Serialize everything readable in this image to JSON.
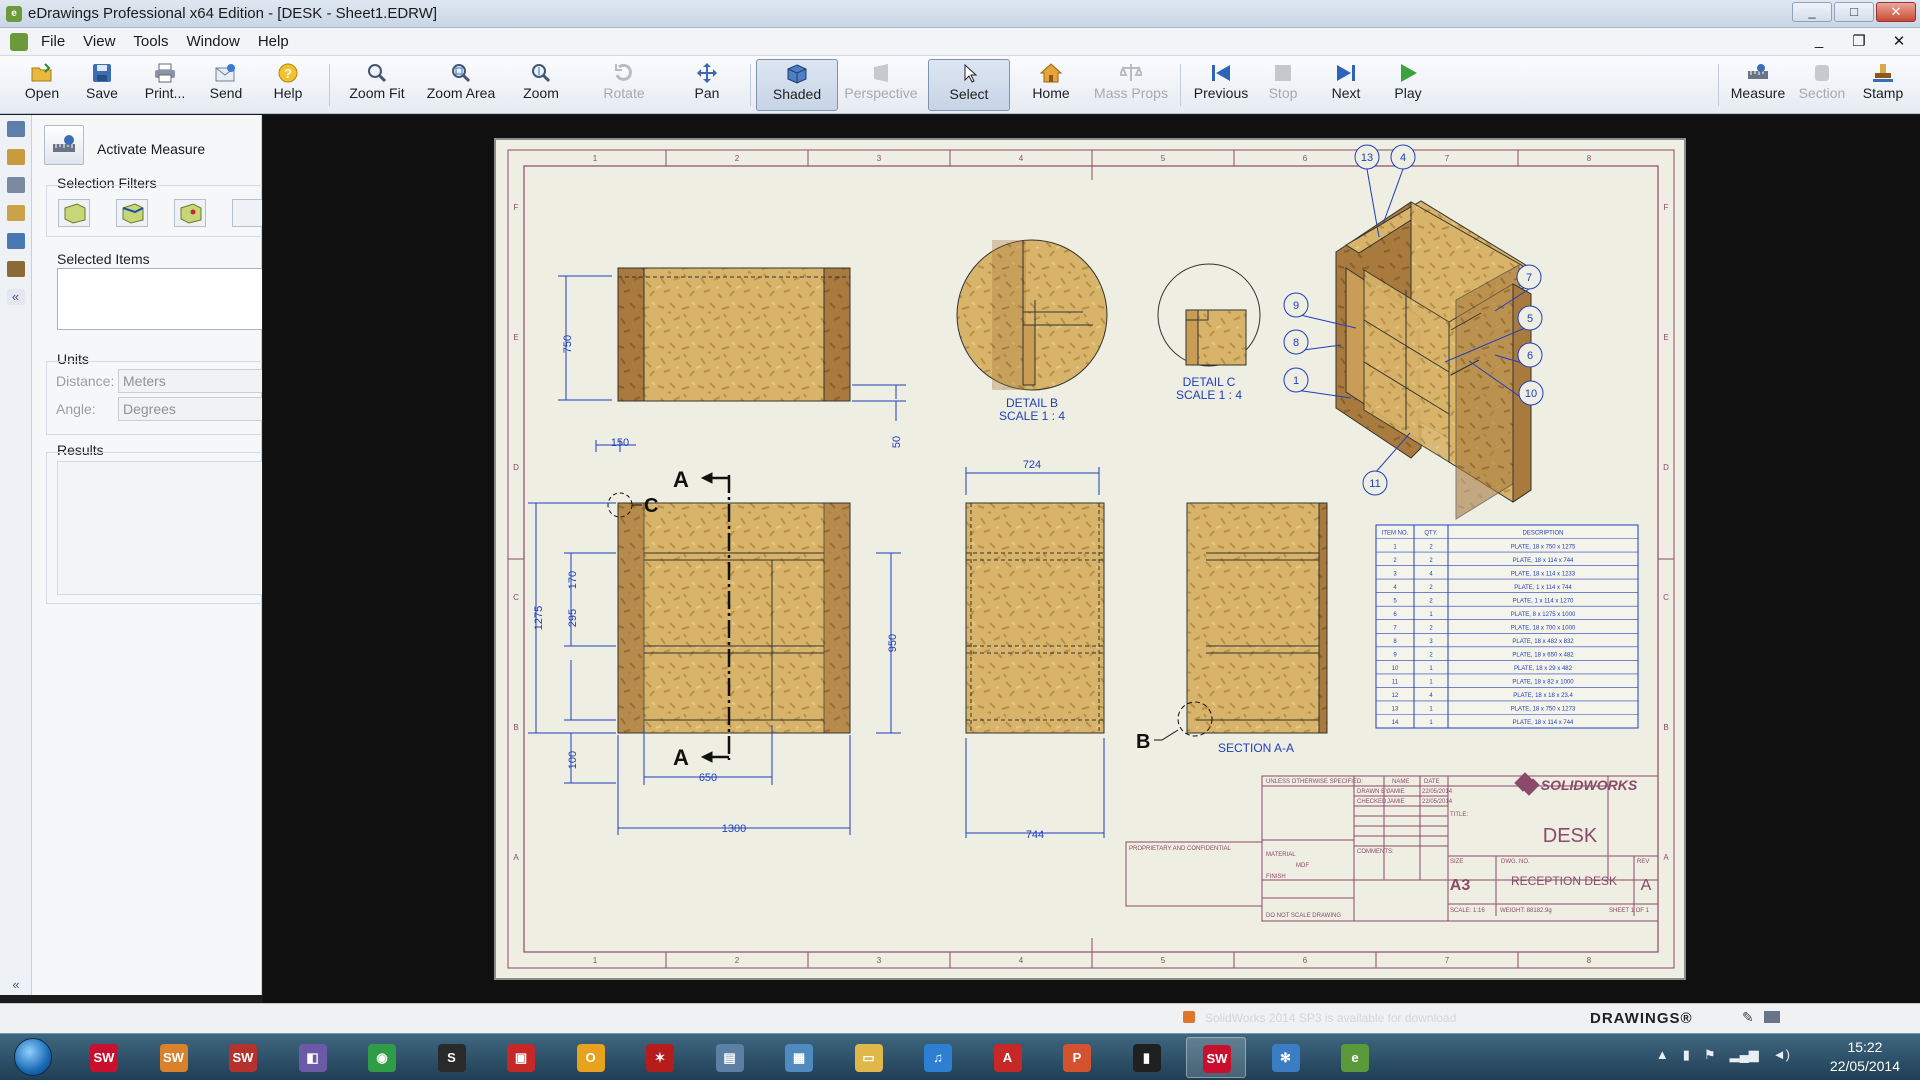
{
  "window": {
    "title": "eDrawings Professional x64 Edition - [DESK - Sheet1.EDRW]",
    "controls": [
      "_",
      "□",
      "✕"
    ]
  },
  "menu": {
    "items": [
      "File",
      "View",
      "Tools",
      "Window",
      "Help"
    ],
    "mdi_controls": [
      "_",
      "❐",
      "✕"
    ]
  },
  "toolbar": {
    "buttons": [
      {
        "label": "Open",
        "icon": "open-folder-icon",
        "enabled": true
      },
      {
        "label": "Save",
        "icon": "save-disk-icon",
        "enabled": true
      },
      {
        "label": "Print...",
        "icon": "printer-icon",
        "enabled": true
      },
      {
        "label": "Send",
        "icon": "send-mail-icon",
        "enabled": true
      },
      {
        "label": "Help",
        "icon": "help-icon",
        "enabled": true
      },
      {
        "label": "Zoom Fit",
        "icon": "zoom-fit-icon",
        "enabled": true
      },
      {
        "label": "Zoom Area",
        "icon": "zoom-area-icon",
        "enabled": true
      },
      {
        "label": "Zoom",
        "icon": "zoom-icon",
        "enabled": true
      },
      {
        "label": "Rotate",
        "icon": "rotate-icon",
        "enabled": false
      },
      {
        "label": "Pan",
        "icon": "pan-icon",
        "enabled": true
      },
      {
        "label": "Shaded",
        "icon": "shaded-cube-icon",
        "enabled": true,
        "pressed": true
      },
      {
        "label": "Perspective",
        "icon": "perspective-icon",
        "enabled": false
      },
      {
        "label": "Select",
        "icon": "select-arrow-icon",
        "enabled": true,
        "pressed": true
      },
      {
        "label": "Home",
        "icon": "home-icon",
        "enabled": true
      },
      {
        "label": "Mass Props",
        "icon": "mass-props-icon",
        "enabled": false
      },
      {
        "label": "Previous",
        "icon": "previous-icon",
        "enabled": true
      },
      {
        "label": "Stop",
        "icon": "stop-icon",
        "enabled": false
      },
      {
        "label": "Next",
        "icon": "next-icon",
        "enabled": true
      },
      {
        "label": "Play",
        "icon": "play-icon",
        "enabled": true
      },
      {
        "label": "Measure",
        "icon": "measure-icon",
        "enabled": true
      },
      {
        "label": "Section",
        "icon": "section-icon",
        "enabled": false
      },
      {
        "label": "Stamp",
        "icon": "stamp-icon",
        "enabled": true
      }
    ]
  },
  "panel": {
    "activate_label": "Activate Measure",
    "selection_filters_label": "Selection Filters",
    "selected_items_label": "Selected Items",
    "units_label": "Units",
    "distance_label": "Distance:",
    "distance_value": "Meters",
    "angle_label": "Angle:",
    "angle_value": "Degrees",
    "results_label": "Results"
  },
  "drawing": {
    "zone_numbers": [
      "1",
      "2",
      "3",
      "4",
      "5",
      "6",
      "7",
      "8"
    ],
    "zone_letters": [
      "A",
      "B",
      "C",
      "D",
      "E",
      "F"
    ],
    "dimensions": {
      "height_750": "750",
      "foot_50": "50",
      "offset_150": "150",
      "height_1275": "1275",
      "shelf_170": "170",
      "shelf_295": "295",
      "base_100": "100",
      "width_650": "650",
      "width_1300": "1300",
      "height_950": "950",
      "width_724": "724",
      "width_744": "744"
    },
    "detail_b_label": "DETAIL B",
    "detail_b_scale": "SCALE 1 : 4",
    "detail_c_label": "DETAIL C",
    "detail_c_scale": "SCALE 1 : 4",
    "section_label": "SECTION A-A",
    "section_mark": "A",
    "detail_mark_b": "B",
    "detail_mark_c": "C",
    "balloons": [
      "13",
      "4",
      "7",
      "9",
      "5",
      "8",
      "6",
      "1",
      "10",
      "11"
    ],
    "bom": {
      "headers": [
        "ITEM NO.",
        "QTY.",
        "DESCRIPTION"
      ],
      "rows": [
        [
          "1",
          "2",
          "PLATE, 18 x 750 x 1275"
        ],
        [
          "2",
          "2",
          "PLATE, 18 x 114 x 744"
        ],
        [
          "3",
          "4",
          "PLATE, 18 x 114 x 1233"
        ],
        [
          "4",
          "2",
          "PLATE, 1 x 114 x 744"
        ],
        [
          "5",
          "2",
          "PLATE, 1 x 114 x 1270"
        ],
        [
          "6",
          "1",
          "PLATE, 8 x 1275 x 1000"
        ],
        [
          "7",
          "2",
          "PLATE, 18 x 700 x 1000"
        ],
        [
          "8",
          "3",
          "PLATE, 18 x 482 x 832"
        ],
        [
          "9",
          "2",
          "PLATE, 18 x 650 x 482"
        ],
        [
          "10",
          "1",
          "PLATE, 18 x 29 x 482"
        ],
        [
          "11",
          "1",
          "PLATE, 18 x 82 x 1000"
        ],
        [
          "12",
          "4",
          "PLATE, 18 x 18 x 23.4"
        ],
        [
          "13",
          "1",
          "PLATE, 18 x 750 x 1273"
        ],
        [
          "14",
          "1",
          "PLATE, 18 x 114 x 744"
        ]
      ]
    },
    "title_block": {
      "brand": "SOLIDWORKS",
      "title_label": "TITLE:",
      "title": "DESK",
      "size_label": "SIZE",
      "size": "A3",
      "dwg_no_label": "DWG.  NO.",
      "dwg_no": "RECEPTION DESK",
      "rev_label": "REV",
      "rev": "A",
      "scale": "SCALE: 1:16",
      "weight": "WEIGHT: 88182.9g",
      "sheet": "SHEET 1 OF 1",
      "unless_note": "UNLESS OTHERWISE SPECIFIED:",
      "name_col": "NAME",
      "date_col": "DATE",
      "drawn_label": "DRAWN BY",
      "drawn_name": "JAMIE",
      "drawn_date": "22/05/2014",
      "checked_label": "CHECKED",
      "checked_name": "JAMIE",
      "checked_date": "22/05/2014",
      "material": "MATERIAL",
      "finish": "FINISH",
      "mdf": "MDF",
      "do_not_scale": "DO NOT SCALE DRAWING",
      "proprietary": "PROPRIETARY AND CONFIDENTIAL",
      "comments": "COMMENTS:"
    }
  },
  "statusbar": {
    "message": "SolidWorks 2014 SP3 is available for download",
    "logo": "DRAWINGS®"
  },
  "taskbar": {
    "apps": [
      {
        "name": "solidworks-icon",
        "glyph": "SW",
        "color": "#c8102e"
      },
      {
        "name": "solidworks-explorer-icon",
        "glyph": "SW",
        "color": "#d9822b"
      },
      {
        "name": "solidworks-toolbox-icon",
        "glyph": "SW",
        "color": "#b5312b"
      },
      {
        "name": "box-3d-icon",
        "glyph": "◧",
        "color": "#6b5aa8"
      },
      {
        "name": "chrome-icon",
        "glyph": "◉",
        "color": "#2f9d47"
      },
      {
        "name": "s-app-icon",
        "glyph": "S",
        "color": "#2a2a2a"
      },
      {
        "name": "red-app-icon",
        "glyph": "▣",
        "color": "#c62828"
      },
      {
        "name": "outlook-icon",
        "glyph": "O",
        "color": "#e8a21d"
      },
      {
        "name": "red-splat-icon",
        "glyph": "✶",
        "color": "#b71c1c"
      },
      {
        "name": "document-viewer-icon",
        "glyph": "▤",
        "color": "#5c7fa3"
      },
      {
        "name": "control-panel-icon",
        "glyph": "▦",
        "color": "#4f8bbf"
      },
      {
        "name": "explorer-folder-icon",
        "glyph": "▭",
        "color": "#e0b84a"
      },
      {
        "name": "itunes-icon",
        "glyph": "♫",
        "color": "#2d7fd1"
      },
      {
        "name": "acrobat-icon",
        "glyph": "A",
        "color": "#c62828"
      },
      {
        "name": "powerpoint-icon",
        "glyph": "P",
        "color": "#d35230"
      },
      {
        "name": "phone-icon",
        "glyph": "▮",
        "color": "#202020"
      },
      {
        "name": "solidworks-active-icon",
        "glyph": "SW",
        "color": "#c8102e"
      },
      {
        "name": "network-snowflake-icon",
        "glyph": "✻",
        "color": "#3b7dc4"
      },
      {
        "name": "edrawings-icon",
        "glyph": "e",
        "color": "#5a9a3a"
      }
    ],
    "time": "15:22",
    "date": "22/05/2014"
  }
}
